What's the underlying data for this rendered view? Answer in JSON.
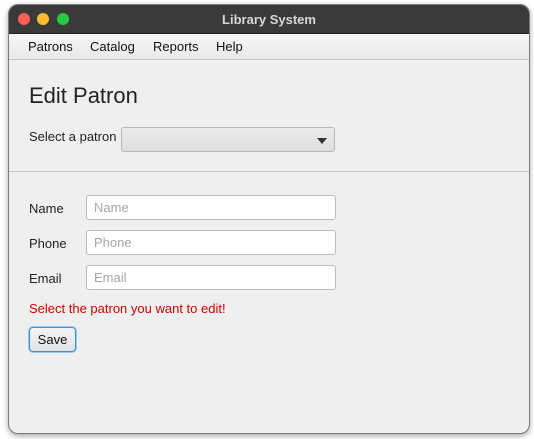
{
  "window": {
    "title": "Library System"
  },
  "menubar": {
    "items": [
      "Patrons",
      "Catalog",
      "Reports",
      "Help"
    ]
  },
  "form": {
    "heading": "Edit Patron",
    "select_label": "Select a patron",
    "selected_patron": "",
    "fields": {
      "name": {
        "label": "Name",
        "value": "",
        "placeholder": "Name"
      },
      "phone": {
        "label": "Phone",
        "value": "",
        "placeholder": "Phone"
      },
      "email": {
        "label": "Email",
        "value": "",
        "placeholder": "Email"
      }
    },
    "error_message": "Select the patron you want to edit!",
    "save_label": "Save"
  },
  "colors": {
    "error": "#d40000",
    "focus_ring": "#3a8fd6",
    "titlebar": "#3a3a3a"
  }
}
